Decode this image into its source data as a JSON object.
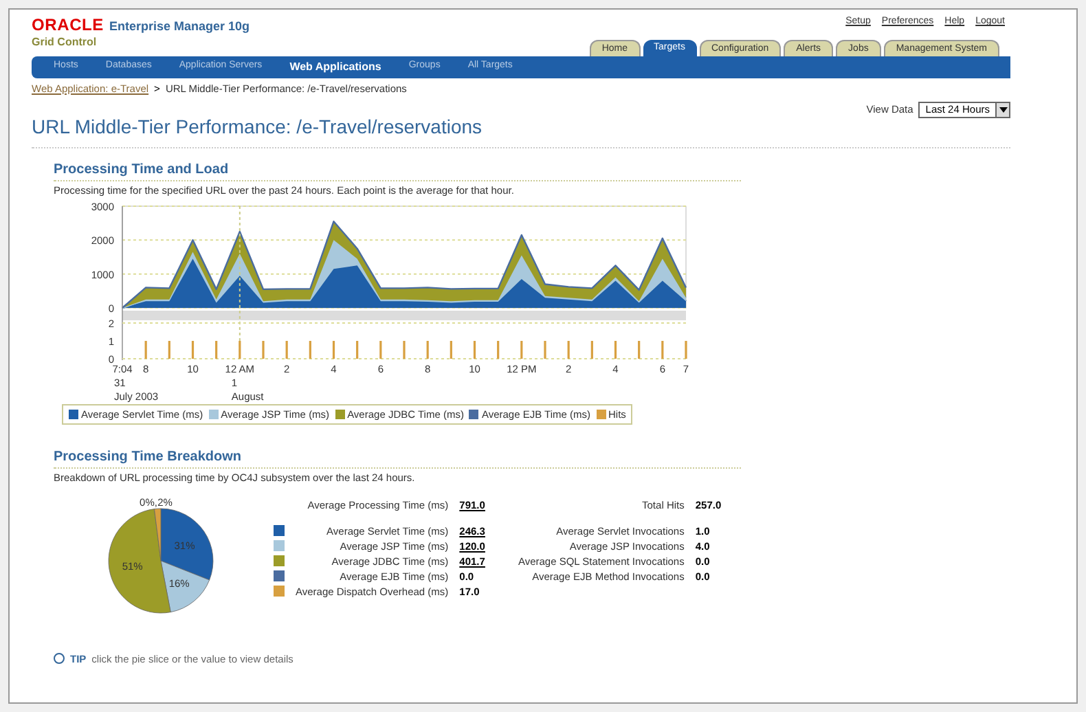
{
  "header": {
    "logo": "ORACLE",
    "product": "Enterprise Manager 10g",
    "subtitle": "Grid Control",
    "global_links": [
      "Setup",
      "Preferences",
      "Help",
      "Logout"
    ]
  },
  "tabs": [
    {
      "label": "Home",
      "selected": false
    },
    {
      "label": "Targets",
      "selected": true
    },
    {
      "label": "Configuration",
      "selected": false
    },
    {
      "label": "Alerts",
      "selected": false
    },
    {
      "label": "Jobs",
      "selected": false
    },
    {
      "label": "Management System",
      "selected": false
    }
  ],
  "subtabs": [
    {
      "label": "Hosts",
      "selected": false
    },
    {
      "label": "Databases",
      "selected": false
    },
    {
      "label": "Application Servers",
      "selected": false
    },
    {
      "label": "Web Applications",
      "selected": true
    },
    {
      "label": "Groups",
      "selected": false
    },
    {
      "label": "All Targets",
      "selected": false
    }
  ],
  "breadcrumb": {
    "link": "Web Application: e-Travel",
    "separator": ">",
    "current": "URL Middle-Tier Performance: /e-Travel/reservations"
  },
  "page_title": "URL Middle-Tier Performance: /e-Travel/reservations",
  "view_data": {
    "label": "View Data",
    "value": "Last 24 Hours"
  },
  "load_section": {
    "title": "Processing Time and Load",
    "description": "Processing time for the specified URL over the past 24 hours. Each point is the average for that hour.",
    "chart_data": {
      "type": "area",
      "stacked": true,
      "categories": [
        "7:04",
        "8",
        null,
        "10",
        null,
        "12 AM",
        null,
        "2",
        null,
        "4",
        null,
        "6",
        null,
        "8",
        null,
        "10",
        null,
        "12 PM",
        null,
        "2",
        null,
        "4",
        null,
        "6",
        "7"
      ],
      "ylim": [
        0,
        3000
      ],
      "yticks": [
        0,
        1000,
        2000,
        3000
      ],
      "annotations": [
        {
          "text": "31"
        },
        {
          "text": "July 2003"
        },
        {
          "text": "1"
        },
        {
          "text": "August"
        }
      ],
      "ref_lines": [
        {
          "axis": "x",
          "value": "12 AM"
        }
      ],
      "series": [
        {
          "name": "Average Servlet Time (ms)",
          "color": "#1f5fa8",
          "values": [
            0,
            200,
            200,
            1450,
            150,
            950,
            150,
            200,
            200,
            1150,
            1250,
            200,
            200,
            180,
            150,
            180,
            180,
            850,
            300,
            250,
            200,
            800,
            150,
            800,
            200
          ]
        },
        {
          "name": "Average JSP Time (ms)",
          "color": "#a8c8dc",
          "values": [
            0,
            50,
            50,
            200,
            100,
            650,
            50,
            50,
            50,
            850,
            200,
            50,
            50,
            50,
            50,
            50,
            50,
            700,
            50,
            50,
            50,
            100,
            50,
            650,
            100
          ]
        },
        {
          "name": "Average JDBC Time (ms)",
          "color": "#9c9c28",
          "values": [
            0,
            350,
            330,
            350,
            300,
            650,
            350,
            310,
            310,
            550,
            300,
            330,
            330,
            370,
            360,
            340,
            340,
            600,
            350,
            320,
            330,
            350,
            330,
            600,
            300
          ]
        }
      ]
    },
    "extra_legend": [
      {
        "name": "Average EJB Time (ms)",
        "color": "#4a6ca0"
      }
    ],
    "hits_chart": {
      "chart_data": {
        "type": "bar",
        "ylim": [
          0,
          2
        ],
        "yticks": [
          0,
          1,
          2
        ],
        "series": [
          {
            "name": "Hits",
            "color": "#d8a040",
            "values": [
              null,
              1,
              1,
              1,
              1,
              1,
              1,
              1,
              1,
              1,
              1,
              1,
              1,
              1,
              1,
              1,
              1,
              1,
              1,
              1,
              1,
              1,
              1,
              1,
              1
            ]
          }
        ]
      }
    }
  },
  "breakdown_section": {
    "title": "Processing Time Breakdown",
    "description": "Breakdown of URL processing time by OC4J subsystem over the last 24 hours.",
    "chart_data": {
      "type": "pie",
      "values": [
        31,
        16,
        51,
        0,
        2
      ],
      "value_labels": [
        "31%",
        "16%",
        "51%",
        "0%,",
        "2%"
      ]
    },
    "summary": [
      {
        "label": "Average Processing Time (ms)",
        "value": "791.0",
        "link": true
      },
      {
        "label": "Total Hits",
        "value": "257.0",
        "link": false
      }
    ],
    "time_rows": [
      {
        "label": "Average Servlet Time (ms)",
        "value": "246.3",
        "link": true,
        "color": "#1f5fa8"
      },
      {
        "label": "Average JSP Time (ms)",
        "value": "120.0",
        "link": true,
        "color": "#a8c8dc"
      },
      {
        "label": "Average JDBC Time (ms)",
        "value": "401.7",
        "link": true,
        "color": "#9c9c28"
      },
      {
        "label": "Average EJB Time (ms)",
        "value": "0.0",
        "link": false,
        "color": "#4a6ca0"
      },
      {
        "label": "Average Dispatch Overhead (ms)",
        "value": "17.0",
        "link": false,
        "color": "#d8a040"
      }
    ],
    "invocation_rows": [
      {
        "label": "Average Servlet Invocations",
        "value": "1.0"
      },
      {
        "label": "Average JSP Invocations",
        "value": "4.0"
      },
      {
        "label": "Average SQL Statement Invocations",
        "value": "0.0"
      },
      {
        "label": "Average EJB Method Invocations",
        "value": "0.0"
      }
    ]
  },
  "tip": {
    "label": "TIP",
    "text": "click the pie slice or the value to view details"
  }
}
